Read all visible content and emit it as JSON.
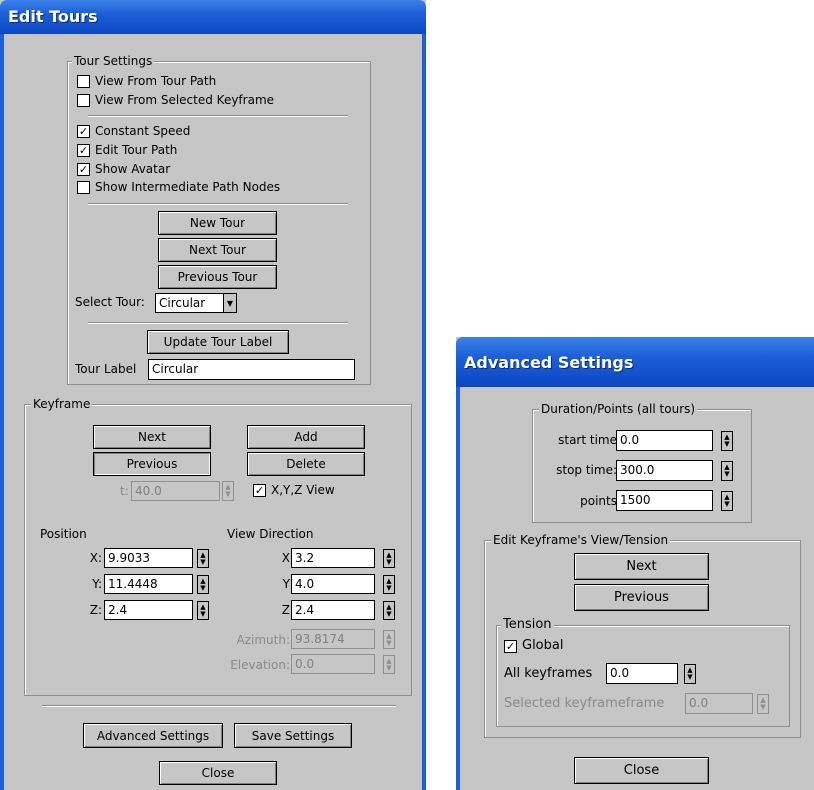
{
  "edit_tours": {
    "title": "Edit Tours",
    "tour_settings": {
      "legend": "Tour Settings",
      "view_from_tour_path": {
        "label": "View From Tour Path",
        "checked": false
      },
      "view_from_selected_keyframe": {
        "label": "View From Selected Keyframe",
        "checked": false
      },
      "constant_speed": {
        "label": "Constant Speed",
        "checked": true
      },
      "edit_tour_path": {
        "label": "Edit Tour Path",
        "checked": true
      },
      "show_avatar": {
        "label": "Show Avatar",
        "checked": true
      },
      "show_intermediate_nodes": {
        "label": "Show Intermediate Path Nodes",
        "checked": false
      },
      "new_tour": "New Tour",
      "next_tour": "Next Tour",
      "previous_tour": "Previous Tour",
      "select_tour_label": "Select Tour:",
      "select_tour_value": "Circular",
      "update_tour_label": "Update Tour Label",
      "tour_label_label": "Tour Label",
      "tour_label_value": "Circular"
    },
    "keyframe": {
      "legend": "Keyframe",
      "next": "Next",
      "add": "Add",
      "previous": "Previous",
      "delete": "Delete",
      "t_label": "t:",
      "t_value": "40.0",
      "xyz_view": {
        "label": "X,Y,Z View",
        "checked": true
      },
      "position_heading": "Position",
      "view_direction_heading": "View Direction",
      "pos_x_label": "X:",
      "pos_x": "9.9033",
      "pos_y_label": "Y:",
      "pos_y": "11.4448",
      "pos_z_label": "Z:",
      "pos_z": "2.4",
      "dir_x_label": "X",
      "dir_x": "3.2",
      "dir_y_label": "Y",
      "dir_y": "4.0",
      "dir_z_label": "Z",
      "dir_z": "2.4",
      "azimuth_label": "Azimuth:",
      "azimuth": "93.8174",
      "elevation_label": "Elevation:",
      "elevation": "0.0"
    },
    "advanced_settings": "Advanced Settings",
    "save_settings": "Save Settings",
    "close": "Close"
  },
  "advanced": {
    "title": "Advanced Settings",
    "duration": {
      "legend": "Duration/Points (all tours)",
      "start_time_label": "start time",
      "start_time": "0.0",
      "stop_time_label": "stop time:",
      "stop_time": "300.0",
      "points_label": "points",
      "points": "1500"
    },
    "edit_keyframe": {
      "legend": "Edit Keyframe's View/Tension",
      "next": "Next",
      "previous": "Previous"
    },
    "tension": {
      "legend": "Tension",
      "global": {
        "label": "Global",
        "checked": true
      },
      "all_keyframes_label": "All keyframes",
      "all_keyframes": "0.0",
      "selected_label": "Selected keyframeframe",
      "selected": "0.0"
    },
    "close": "Close"
  },
  "icons": {
    "check": "✓",
    "spin_up": "▲",
    "spin_down": "▼",
    "dropdown": "▼"
  },
  "colors": {
    "titlebar": "#1d5fd6",
    "dialog_bg": "#c6c6c6"
  }
}
